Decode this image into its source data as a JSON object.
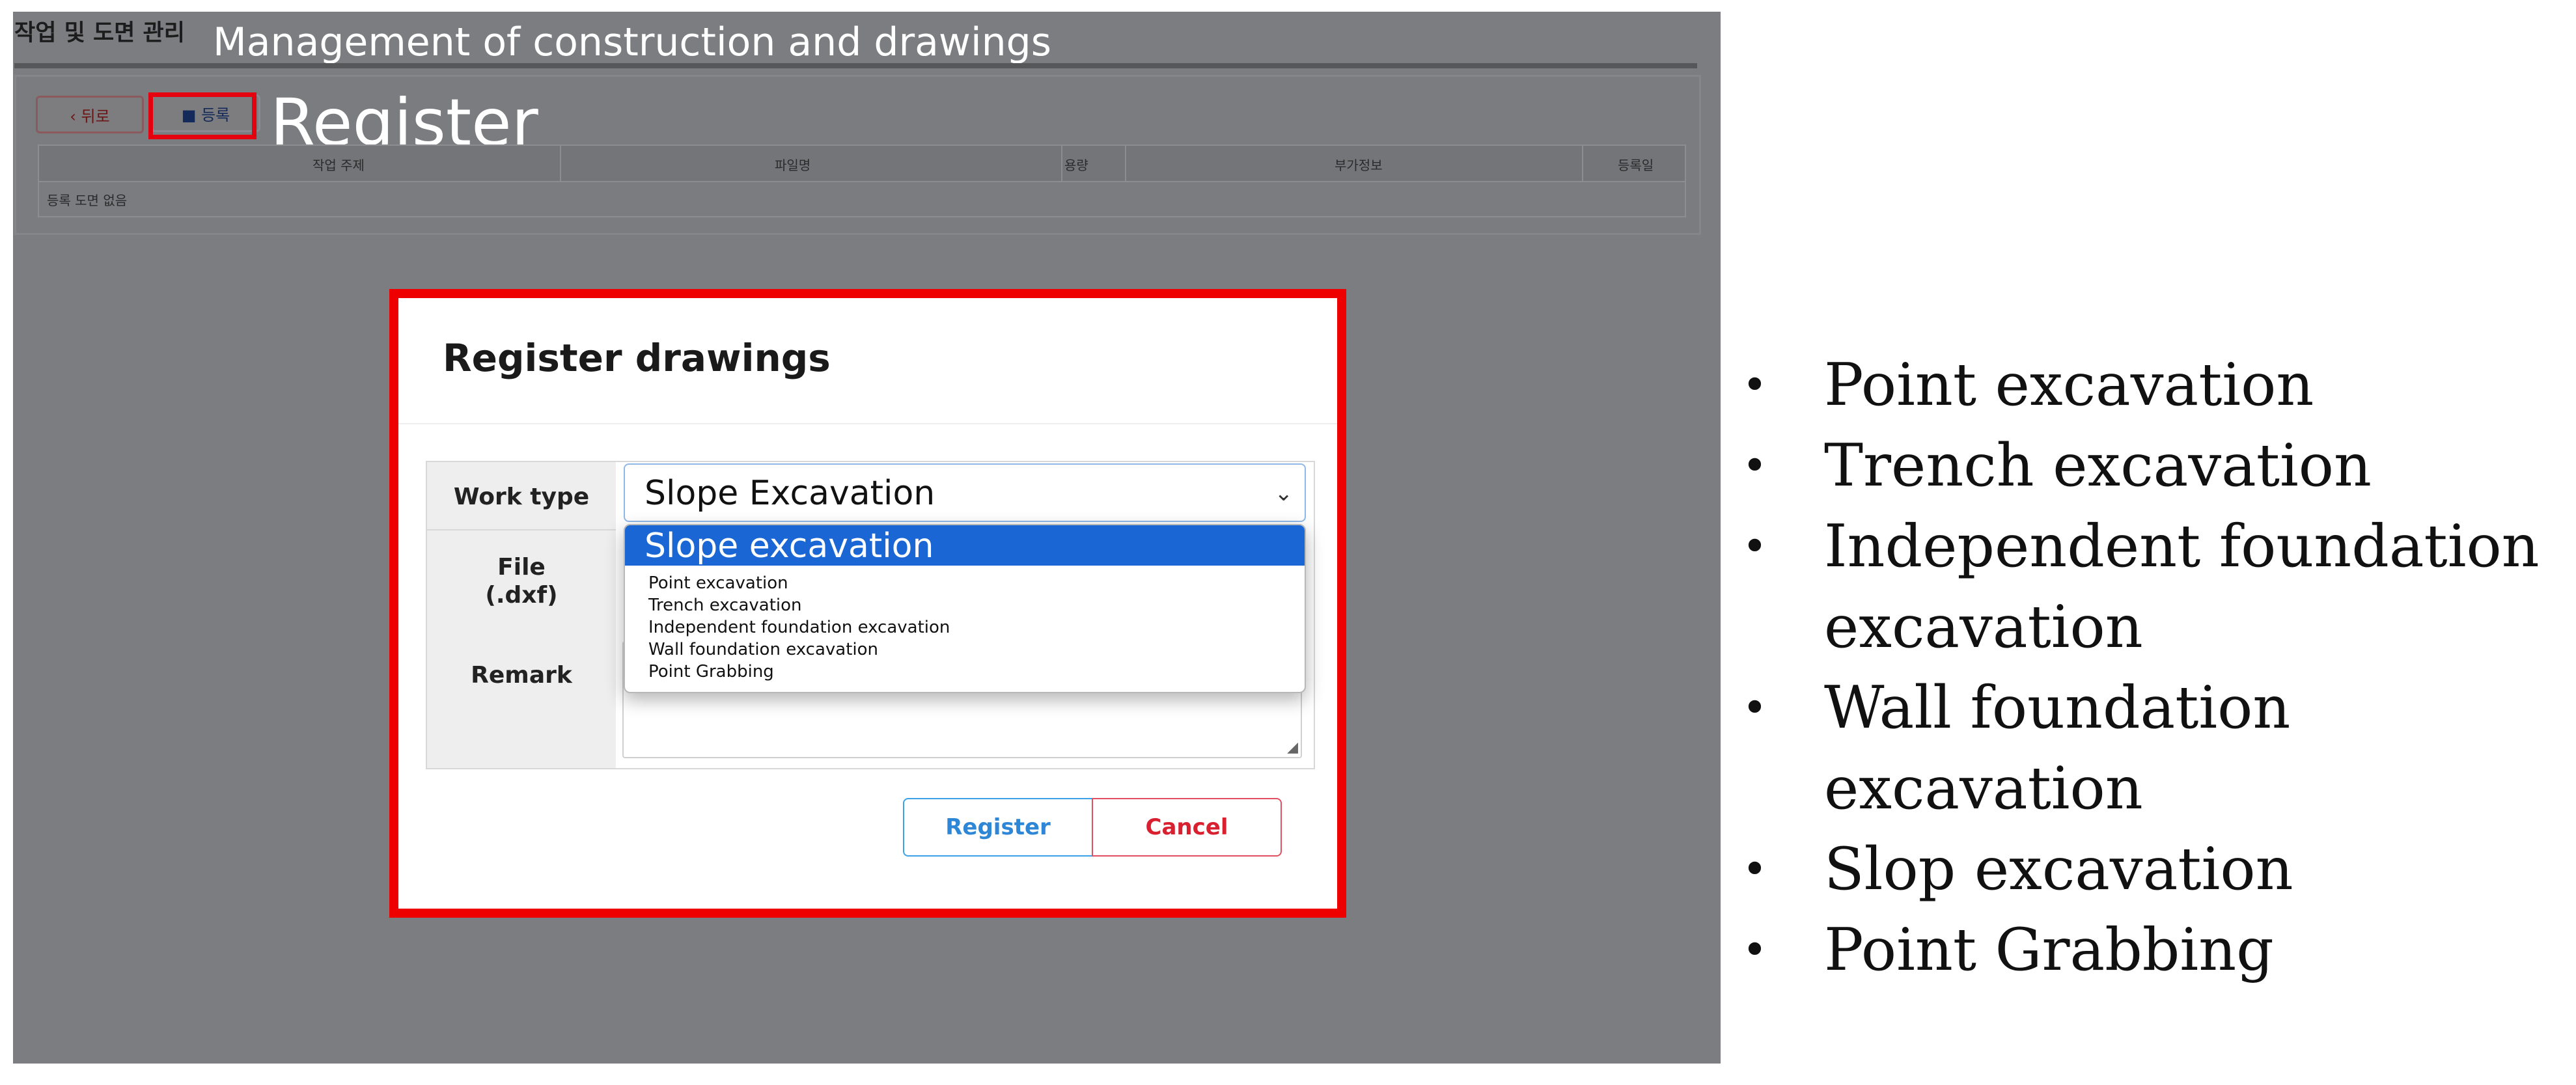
{
  "header": {
    "korean_title": "작업 및 도면 관리",
    "annotation_title": "Management of construction and drawings",
    "annotation_register": "Register"
  },
  "toolbar": {
    "back_label": "‹ 뒤로",
    "register_label": "■ 등록"
  },
  "table": {
    "columns": [
      "작업 주제",
      "파일명",
      "용량",
      "부가정보",
      "등록일"
    ],
    "empty_text": "등록 도면 없음"
  },
  "modal": {
    "title": "Register drawings",
    "work_type_label": "Work type",
    "file_label": "File\n(.dxf)",
    "remark_label": "Remark",
    "selected_value": "Slope Excavation",
    "register_button": "Register",
    "cancel_button": "Cancel"
  },
  "dropdown": {
    "highlighted": "Slope excavation",
    "options": [
      "Point  excavation",
      "Trench  excavation",
      "Independent  foundation  excavation",
      "Wall  foundation  excavation",
      "Point  Grabbing"
    ]
  },
  "bullets": [
    "Point excavation",
    "Trench excavation",
    "Independent foundation excavation",
    "Wall foundation excavation",
    "Slop excavation",
    "Point Grabbing"
  ],
  "colors": {
    "overlay": "#7c7d80",
    "highlight_border": "#ee0000",
    "selected_option": "#1a66d4",
    "register_button": "#2d86d6",
    "cancel_button": "#d82030"
  }
}
